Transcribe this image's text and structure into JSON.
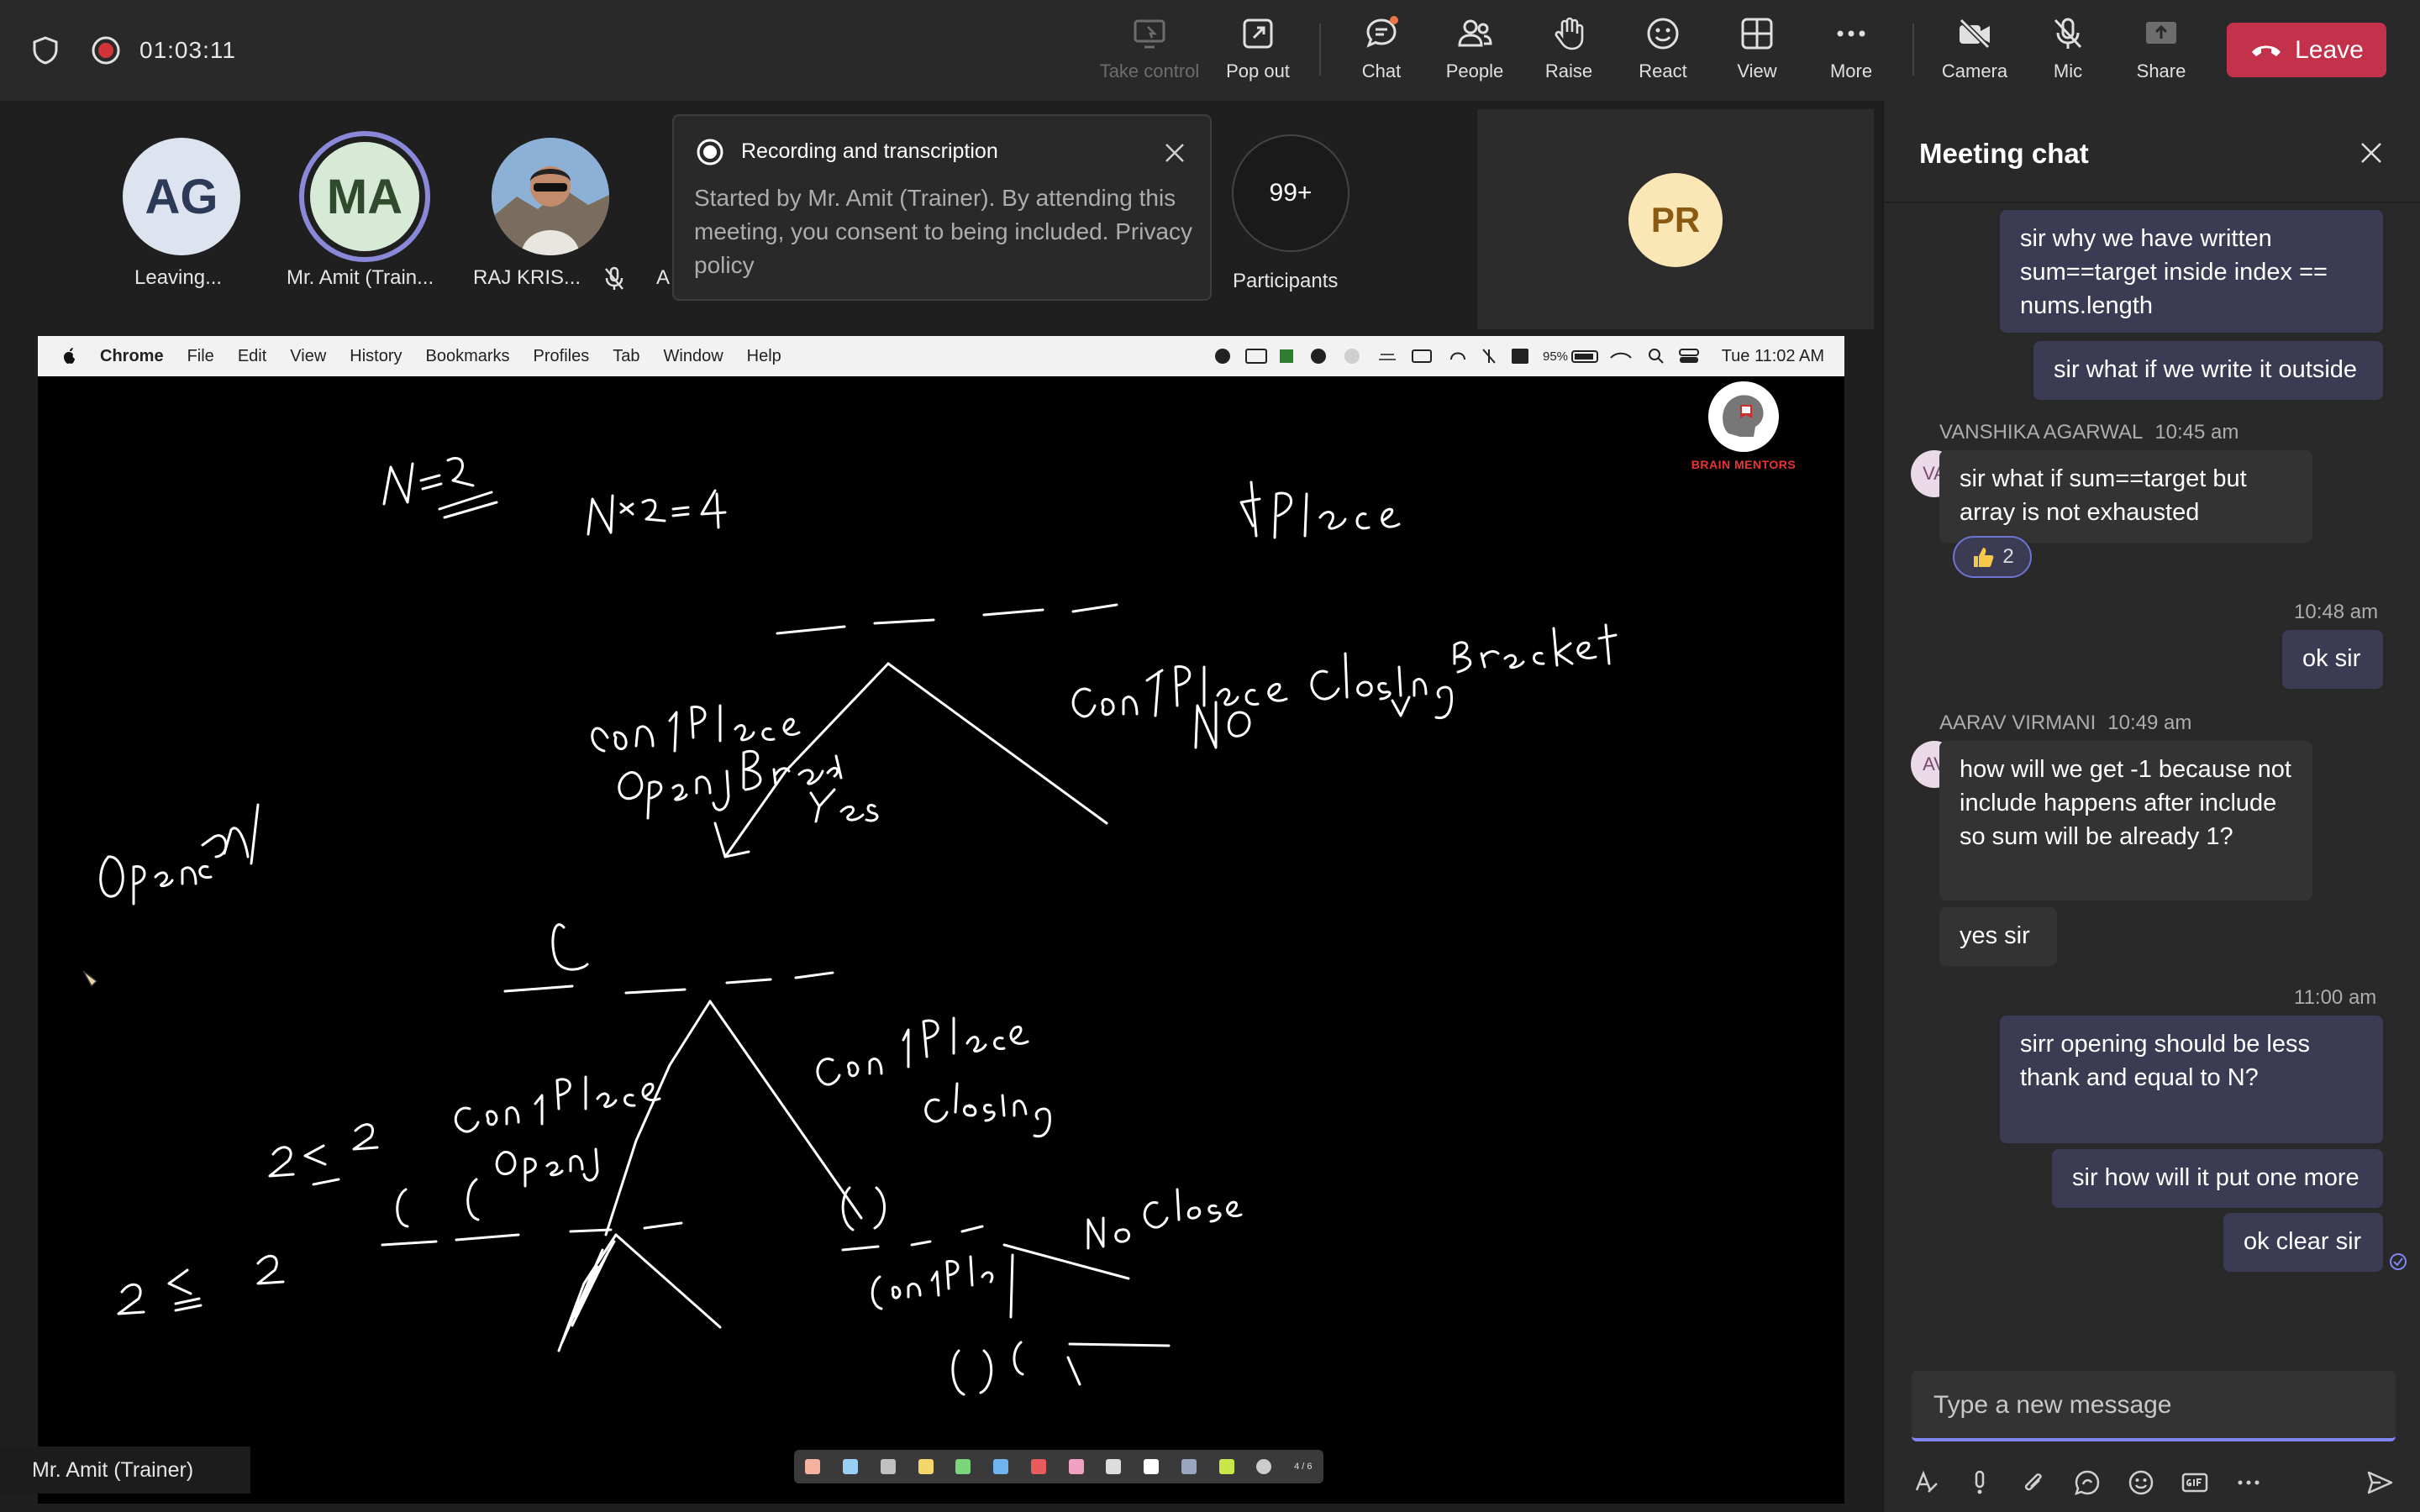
{
  "call": {
    "timer": "01:03:11",
    "leave_label": "Leave",
    "buttons": {
      "take_control": "Take control",
      "pop_out": "Pop out",
      "chat": "Chat",
      "people": "People",
      "raise": "Raise",
      "react": "React",
      "view": "View",
      "more": "More",
      "camera": "Camera",
      "mic": "Mic",
      "share": "Share"
    }
  },
  "participants": {
    "tiles": [
      {
        "initials": "AG",
        "name": "Leaving..."
      },
      {
        "initials": "MA",
        "name": "Mr. Amit (Train..."
      },
      {
        "initials": "",
        "name": "RAJ KRIS..."
      },
      {
        "initials": "",
        "name": "A"
      }
    ],
    "overflow_count": "99+",
    "overflow_label": "Participants",
    "pr_initials": "PR"
  },
  "recording_popup": {
    "title": "Recording and transcription",
    "body": "Started by Mr. Amit (Trainer). By attending this meeting, you consent to being included. Privacy policy"
  },
  "shared_screen": {
    "menubar": [
      "Chrome",
      "File",
      "Edit",
      "View",
      "History",
      "Bookmarks",
      "Profiles",
      "Tab",
      "Window",
      "Help"
    ],
    "battery": "95%",
    "clock": "Tue 11:02 AM",
    "brand": "BRAIN MENTORS",
    "presenter_name": "Mr. Amit (Trainer)",
    "toolbar_page": "4 / 6"
  },
  "chat": {
    "title": "Meeting chat",
    "messages": [
      {
        "sender": "",
        "time": "",
        "text": "sir why we have written sum==target inside index == nums.length"
      },
      {
        "sender": "",
        "time": "",
        "text": "sir what if we write it outside"
      },
      {
        "sender": "VANSHIKA AGARWAL",
        "initials": "VA",
        "time": "10:45 am",
        "text": "sir what if sum==target but array is not exhausted",
        "reaction_count": "2"
      },
      {
        "sender": "",
        "time": "10:48 am",
        "text": "ok sir"
      },
      {
        "sender": "AARAV VIRMANI",
        "initials": "AV",
        "time": "10:49 am",
        "text": "how will we get -1 because not include happens after include so sum will be already 1?"
      },
      {
        "sender": "",
        "time": "",
        "text": "yes sir"
      },
      {
        "sender": "",
        "time": "11:00 am",
        "text": "sirr opening should be less thank and equal to N?"
      },
      {
        "sender": "",
        "time": "",
        "text": "sir how will it put one more"
      },
      {
        "sender": "",
        "time": "",
        "text": "ok clear sir"
      }
    ],
    "compose_placeholder": "Type a new message"
  }
}
